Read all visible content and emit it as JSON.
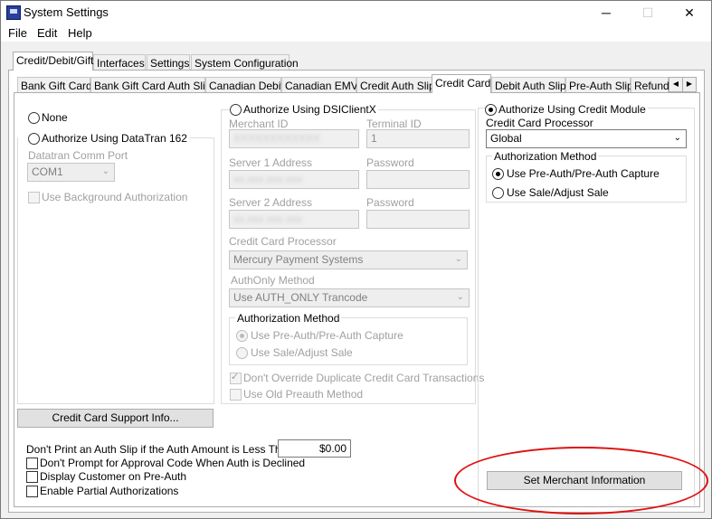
{
  "window": {
    "title": "System Settings",
    "minimize": "─",
    "maximize": "☐",
    "close": "✕"
  },
  "menu": [
    "File",
    "Edit",
    "Help"
  ],
  "main_tabs": [
    "Credit/Debit/Gift",
    "Interfaces",
    "Settings",
    "System Configuration"
  ],
  "sub_tabs": [
    "Bank Gift Card",
    "Bank Gift Card Auth Slip",
    "Canadian Debit",
    "Canadian EMV",
    "Credit Auth Slip",
    "Credit Card",
    "Debit Auth Slip",
    "Pre-Auth Slip",
    "Refund"
  ],
  "sub_tab_scroll": {
    "left": "◀",
    "right": "▶"
  },
  "left_section": {
    "none_label": "None",
    "datatran_label": "Authorize Using DataTran 162",
    "comm_port_label": "Datatran Comm Port",
    "comm_port_value": "COM1",
    "background_auth_label": "Use Background Authorization",
    "support_button": "Credit Card Support Info..."
  },
  "dsi_section": {
    "radio_label": "Authorize Using DSIClientX",
    "merchant_id_label": "Merchant ID",
    "merchant_id_value": "XXXXXXXXXXXX",
    "terminal_id_label": "Terminal ID",
    "terminal_id_value": "1",
    "server1_label": "Server 1 Address",
    "server1_value": "xx.xxx.xxx.xxx",
    "password1_label": "Password",
    "server2_label": "Server 2 Address",
    "server2_value": "xx.xxx.xxx.xxx",
    "password2_label": "Password",
    "processor_label": "Credit Card Processor",
    "processor_value": "Mercury Payment Systems",
    "authonly_label": "AuthOnly Method",
    "authonly_value": "Use AUTH_ONLY Trancode",
    "auth_method_title": "Authorization Method",
    "preauth_label": "Use Pre-Auth/Pre-Auth Capture",
    "sale_label": "Use Sale/Adjust Sale",
    "no_override_label": "Don't Override Duplicate Credit Card Transactions",
    "old_preauth_label": "Use Old Preauth Method"
  },
  "module_section": {
    "radio_label": "Authorize Using Credit Module",
    "processor_label": "Credit Card Processor",
    "processor_value": "Global",
    "auth_method_title": "Authorization Method",
    "preauth_label": "Use Pre-Auth/Pre-Auth Capture",
    "sale_label": "Use Sale/Adjust Sale",
    "set_merchant_button": "Set Merchant Information"
  },
  "bottom": {
    "auth_slip_label": "Don't Print an Auth Slip if the Auth Amount is Less Than",
    "auth_slip_value": "$0.00",
    "no_prompt_label": "Don't Prompt for Approval Code When Auth is Declined",
    "display_customer_label": "Display Customer on Pre-Auth",
    "partial_auth_label": "Enable Partial Authorizations"
  },
  "colors": {
    "annotation": "#e01010",
    "panel": "#ffffff",
    "chrome": "#f0f0f0"
  }
}
